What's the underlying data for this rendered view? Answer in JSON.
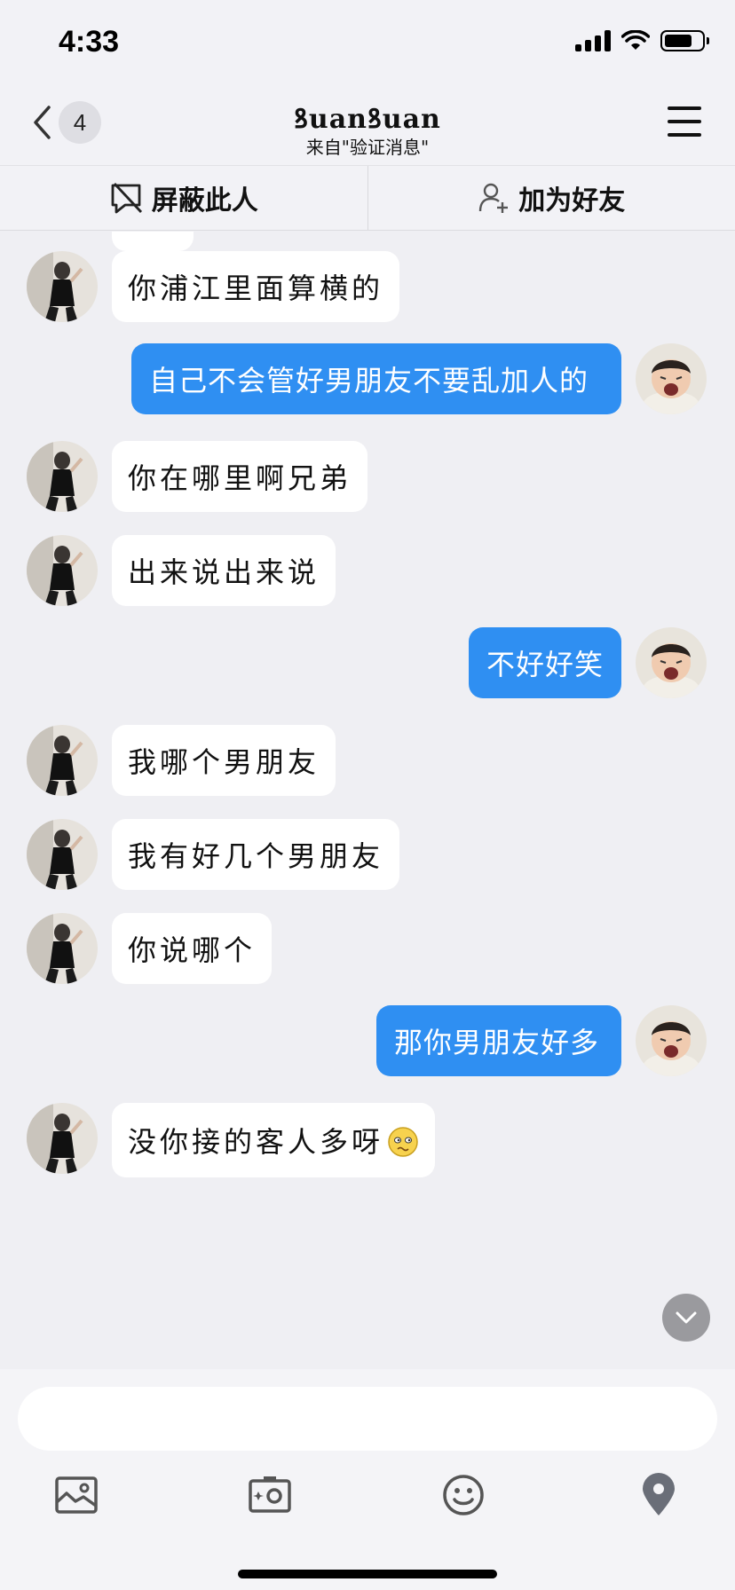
{
  "status_bar": {
    "time": "4:33"
  },
  "nav": {
    "back_count": "4",
    "title": "ꝸuanꝸuan",
    "subtitle": "来自\"验证消息\""
  },
  "actions": {
    "block_label": "屏蔽此人",
    "add_friend_label": "加为好友"
  },
  "messages": [
    {
      "side": "in",
      "text": "你浦江里面算横的"
    },
    {
      "side": "out",
      "text": "自己不会管好男朋友不要乱加人的"
    },
    {
      "side": "in",
      "text": "你在哪里啊兄弟"
    },
    {
      "side": "in",
      "text": "出来说出来说"
    },
    {
      "side": "out",
      "text": "不好好笑"
    },
    {
      "side": "in",
      "text": "我哪个男朋友"
    },
    {
      "side": "in",
      "text": "我有好几个男朋友"
    },
    {
      "side": "in",
      "text": "你说哪个"
    },
    {
      "side": "out",
      "text": "那你男朋友好多"
    },
    {
      "side": "in",
      "text": "没你接的客人多呀",
      "emoji": "emoji-face-icon"
    }
  ],
  "input": {
    "placeholder": ""
  },
  "toolbar": {
    "items": [
      "photo-icon",
      "camera-icon",
      "emoji-icon",
      "location-icon"
    ]
  },
  "colors": {
    "outgoing_bubble": "#2f8ff2",
    "incoming_bubble": "#ffffff",
    "chat_background": "#efeff3"
  }
}
